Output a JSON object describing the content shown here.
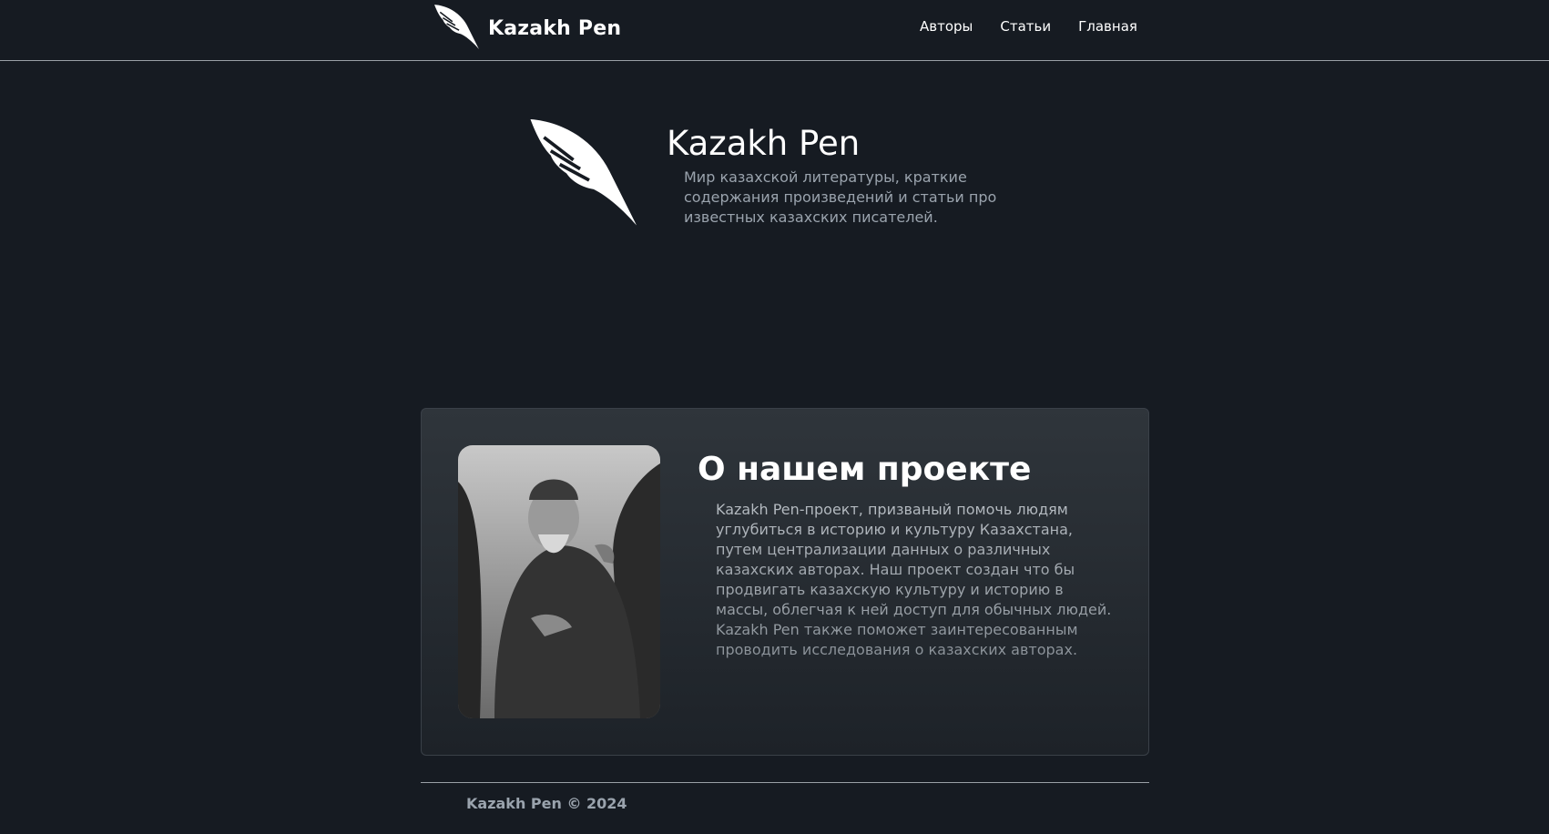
{
  "navbar": {
    "brand": "Kazakh Pen",
    "brand_icon": "feather-icon",
    "links": [
      "Авторы",
      "Статьи",
      "Главная"
    ]
  },
  "hero": {
    "title": "Kazakh Pen",
    "description": "Мир казахской литературы, краткие содержания произведений и статьи про известных казахских писателей."
  },
  "about": {
    "title": "О нашем проекте",
    "text": "Kazakh Pen-проект, призваный помочь людям углубиться в историю и культуру Казахстана, путем централизации данных о различных казахских авторах. Наш проект создан что бы продвигать казахскую культуру и историю в массы, облегчая к ней доступ для обычных людей. Kazakh Pen также поможет заинтересованным проводить исследования о казахских авторах."
  },
  "footer": {
    "text": "Kazakh Pen © 2024"
  },
  "colors": {
    "background": "#161b22",
    "card_top": "#2f353b",
    "card_bottom": "#1d2228",
    "muted_text": "#9aa3ad"
  }
}
